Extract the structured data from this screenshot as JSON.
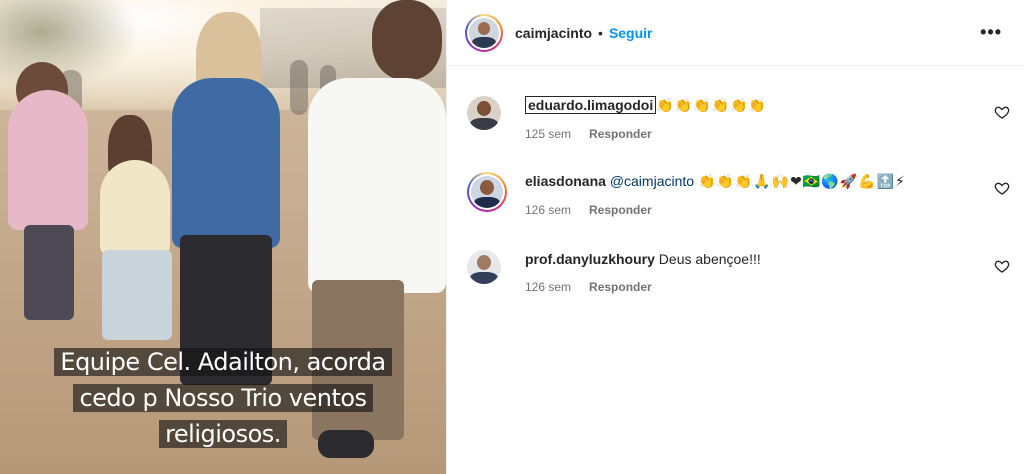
{
  "post": {
    "author": "caimjacinto",
    "follow_label": "Seguir",
    "separator": "•",
    "more_label": "•••"
  },
  "media": {
    "caption_lines": [
      "Equipe Cel. Adailton,  acorda",
      "cedo p Nosso Trio ventos",
      "religiosos."
    ]
  },
  "comments": [
    {
      "user": "eduardo.limagodoi",
      "mention": "",
      "text": "",
      "emoji": "👏👏👏👏👏👏",
      "time": "125 sem",
      "reply_label": "Responder"
    },
    {
      "user": "eliasdonana",
      "mention": "@caimjacinto",
      "text": "",
      "emoji": "👏👏👏🙏🙌❤🇧🇷🌎🚀💪🔝⚡",
      "time": "126 sem",
      "reply_label": "Responder"
    },
    {
      "user": "prof.danyluzkhoury",
      "mention": "",
      "text": "Deus abençoe!!!",
      "emoji": "",
      "time": "126 sem",
      "reply_label": "Responder"
    }
  ],
  "icons": {
    "heart": "heart-icon",
    "more": "more-options-icon"
  },
  "colors": {
    "accent": "#0095f6",
    "text": "#262626",
    "muted": "#737373",
    "mention": "#00376b"
  }
}
